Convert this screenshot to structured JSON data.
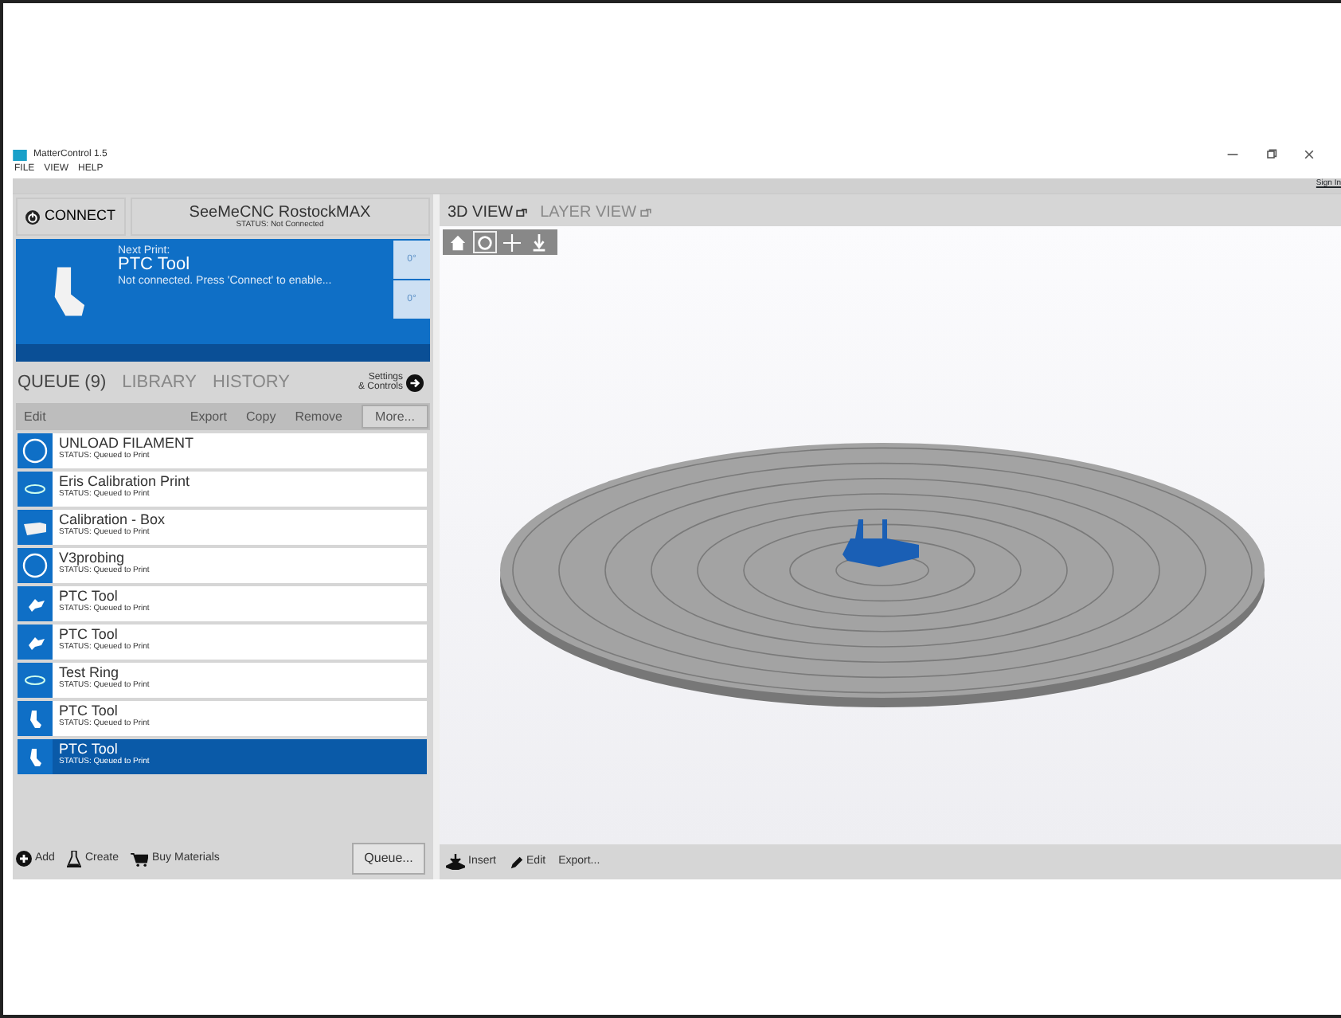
{
  "window": {
    "title": "MatterControl 1.5"
  },
  "menu": [
    "FILE",
    "VIEW",
    "HELP"
  ],
  "sign_in": "Sign In",
  "printer": {
    "connect": "CONNECT",
    "name": "SeeMeCNC RostockMAX",
    "status": "STATUS: Not Connected"
  },
  "next_print": {
    "label": "Next Print:",
    "name": "PTC Tool",
    "message": "Not connected. Press 'Connect' to enable...",
    "temperatures": [
      "0°",
      "0°"
    ]
  },
  "tabs": [
    {
      "label": "QUEUE (9)",
      "selected": true
    },
    {
      "label": "LIBRARY",
      "selected": false
    },
    {
      "label": "HISTORY",
      "selected": false
    }
  ],
  "settings_button": [
    "Settings",
    "& Controls"
  ],
  "queue_toolbar": {
    "edit": "Edit",
    "actions": [
      "Export",
      "Copy",
      "Remove"
    ],
    "more": "More..."
  },
  "queue": [
    {
      "name": "UNLOAD FILAMENT",
      "status": "STATUS: Queued to Print",
      "kind": "gcode",
      "selected": false
    },
    {
      "name": "Eris Calibration Print",
      "status": "STATUS: Queued to Print",
      "kind": "ring",
      "selected": false
    },
    {
      "name": "Calibration - Box",
      "status": "STATUS: Queued to Print",
      "kind": "box",
      "selected": false
    },
    {
      "name": "V3probing",
      "status": "STATUS: Queued to Print",
      "kind": "gcode",
      "selected": false
    },
    {
      "name": "PTC Tool",
      "status": "STATUS: Queued to Print",
      "kind": "tool",
      "selected": false
    },
    {
      "name": "PTC Tool",
      "status": "STATUS: Queued to Print",
      "kind": "tool",
      "selected": false
    },
    {
      "name": "Test Ring",
      "status": "STATUS: Queued to Print",
      "kind": "ring",
      "selected": false
    },
    {
      "name": "PTC Tool",
      "status": "STATUS: Queued to Print",
      "kind": "sock",
      "selected": false
    },
    {
      "name": "PTC Tool",
      "status": "STATUS: Queued to Print",
      "kind": "sock",
      "selected": true
    }
  ],
  "queue_footer": {
    "add": "Add",
    "create": "Create",
    "buy": "Buy Materials",
    "queue": "Queue..."
  },
  "view_tabs": [
    {
      "label": "3D VIEW",
      "selected": true
    },
    {
      "label": "LAYER VIEW",
      "selected": false
    }
  ],
  "view_tools": [
    {
      "kind": "home",
      "selected": false
    },
    {
      "kind": "rotate",
      "selected": true
    },
    {
      "kind": "move",
      "selected": false
    },
    {
      "kind": "zoom",
      "selected": false
    }
  ],
  "view_footer": {
    "insert": "Insert",
    "edit": "Edit",
    "export": "Export..."
  }
}
